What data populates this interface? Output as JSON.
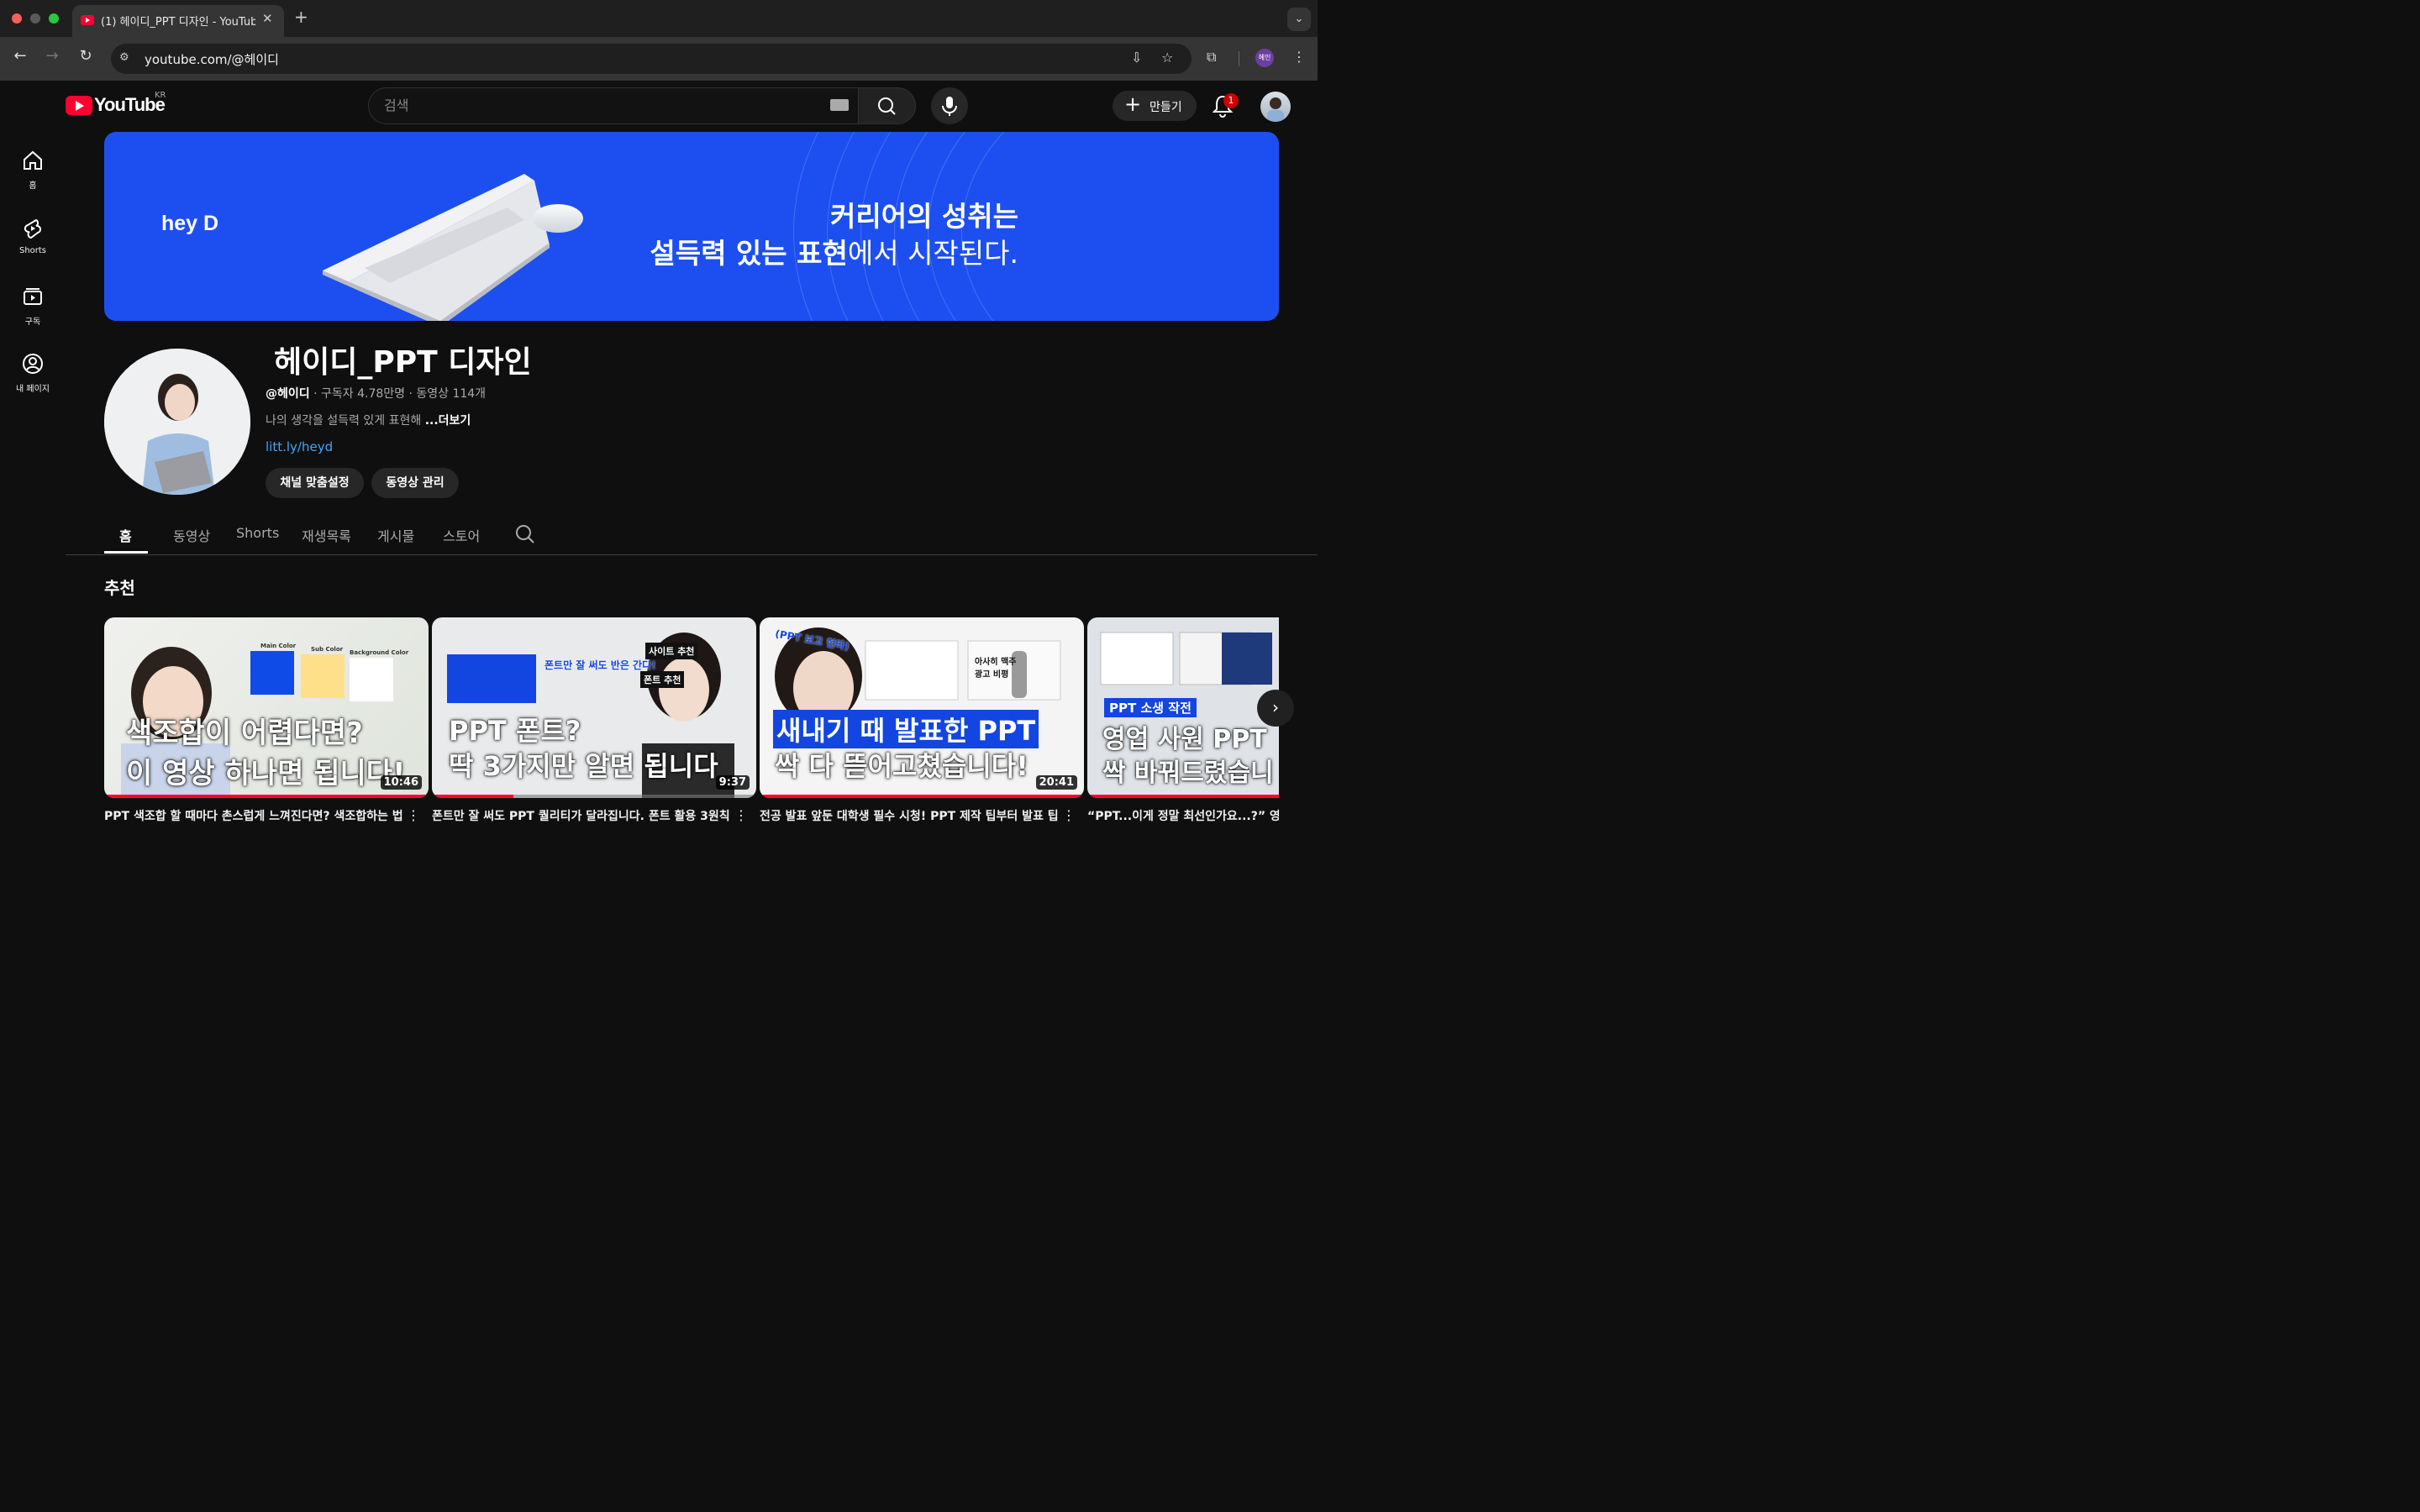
{
  "browser": {
    "tab_title": "(1) 헤이디_PPT 디자인 - YouTube",
    "url": "youtube.com/@헤이디",
    "profile_label": "혜인"
  },
  "header": {
    "logo_text": "YouTube",
    "region": "KR",
    "search_placeholder": "검색",
    "create_label": "만들기",
    "notification_count": "1"
  },
  "sidebar": {
    "items": [
      {
        "label": "홈",
        "icon": "home-icon"
      },
      {
        "label": "Shorts",
        "icon": "shorts-icon"
      },
      {
        "label": "구독",
        "icon": "subscriptions-icon"
      },
      {
        "label": "내 페이지",
        "icon": "you-icon"
      }
    ]
  },
  "banner": {
    "logo": "hey D",
    "line1": "커리어의 성취는",
    "line2_bold": "설득력 있는 표현",
    "line2_rest": "에서 시작된다."
  },
  "channel": {
    "name": "헤이디_PPT 디자인",
    "handle": "@헤이디",
    "meta": " · 구독자 4.78만명 · 동영상 114개",
    "description": "나의 생각을 설득력 있게 표현해 ",
    "more": "...더보기",
    "link": "litt.ly/heyd",
    "customize_button": "채널 맞춤설정",
    "manage_button": "동영상 관리"
  },
  "tabs": [
    "홈",
    "동영상",
    "Shorts",
    "재생목록",
    "게시물",
    "스토어"
  ],
  "section_title": "추천",
  "videos": [
    {
      "title": "PPT 색조합 할 때마다 촌스럽게 느껴진다면? 색조합하는 법",
      "duration": "10:46",
      "progress": 1.0,
      "thumb_line1": "색조합이 어렵다면?",
      "thumb_line2": "이 영상 하나면 됩니다!",
      "thumb_labels": [
        "Main Color",
        "Sub Color",
        "Background Color"
      ]
    },
    {
      "title": "폰트만 잘 써도 PPT 퀄리티가 달라집니다. 폰트 활용 3원칙",
      "duration": "9:37",
      "progress": 0.25,
      "thumb_line1": "PPT 폰트?",
      "thumb_line2": "딱 3가지만 알면 됩니다",
      "thumb_tags": [
        "폰트만 잘 써도 반은 간다!",
        "사이트 추천",
        "폰트 추천"
      ]
    },
    {
      "title": "전공 발표 앞둔 대학생 필수 시청! PPT 제작 팁부터 발표 팁",
      "duration": "20:41",
      "progress": 1.0,
      "thumb_line1": "새내기 때 발표한 PPT",
      "thumb_line2": "싹 다 뜯어고쳤습니다!",
      "thumb_tags": [
        "(PPT 보고 현타)",
        "아사히 맥주 광고 비평"
      ]
    },
    {
      "title": "“PPT...이게 정말 최선인가요...?” 영업",
      "duration": "",
      "progress": 1.0,
      "thumb_line1": "영업 사원 PPT",
      "thumb_line2": "싹 바꿔드렸습니",
      "thumb_tags": [
        "PPT 소생 작전"
      ]
    }
  ],
  "colors": {
    "background": "#0f0f0f",
    "banner_blue": "#1d4ff0",
    "accent_red": "#ff0033",
    "link_blue": "#3ea6ff"
  }
}
